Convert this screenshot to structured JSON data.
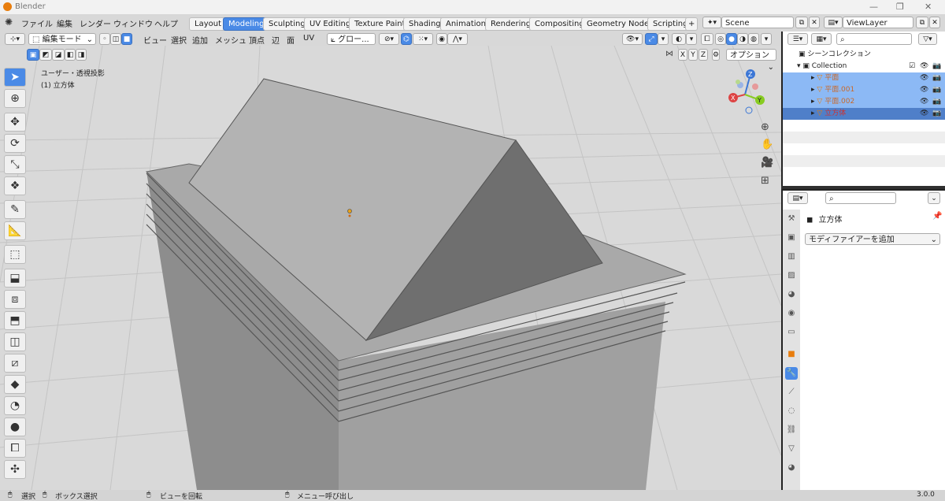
{
  "window": {
    "title": "Blender"
  },
  "menus": [
    "ファイル",
    "編集",
    "レンダー",
    "ウィンドウ",
    "ヘルプ"
  ],
  "workspace_tabs": [
    "Layout",
    "Modeling",
    "Sculpting",
    "UV Editing",
    "Texture Paint",
    "Shading",
    "Animation",
    "Rendering",
    "Compositing",
    "Geometry Nodes",
    "Scripting"
  ],
  "active_tab": "Modeling",
  "scene": {
    "name": "Scene"
  },
  "view_layer": {
    "name": "ViewLayer"
  },
  "viewport_header": {
    "mode": "編集モード",
    "menus": [
      "ビュー",
      "選択",
      "追加",
      "メッシュ",
      "頂点",
      "辺",
      "面",
      "UV"
    ],
    "transform_orientation": "グロー...",
    "axes": [
      "X",
      "Y",
      "Z"
    ],
    "options_label": "オプション"
  },
  "viewport": {
    "view_name": "ユーザー・透視投影",
    "object_label": "(1) 立方体",
    "gizmo_axes": {
      "x": "X",
      "y": "Y",
      "z": "Z"
    }
  },
  "outliner": {
    "root": "シーンコレクション",
    "collection": "Collection",
    "items": [
      {
        "name": "平面",
        "state": "selected"
      },
      {
        "name": "平面.001",
        "state": "selected"
      },
      {
        "name": "平面.002",
        "state": "selected"
      },
      {
        "name": "立方体",
        "state": "active"
      }
    ]
  },
  "properties": {
    "object_name": "立方体",
    "add_modifier": "モディファイアーを追加"
  },
  "statusbar": {
    "items": [
      "選択",
      "ボックス選択",
      "ビューを回転",
      "メニュー呼び出し"
    ],
    "version": "3.0.0"
  },
  "colors": {
    "accent": "#4a8ae6",
    "selected_row": "#8cb9f5",
    "active_row": "#4f7fc9",
    "object_orange": "#e87d0d"
  }
}
